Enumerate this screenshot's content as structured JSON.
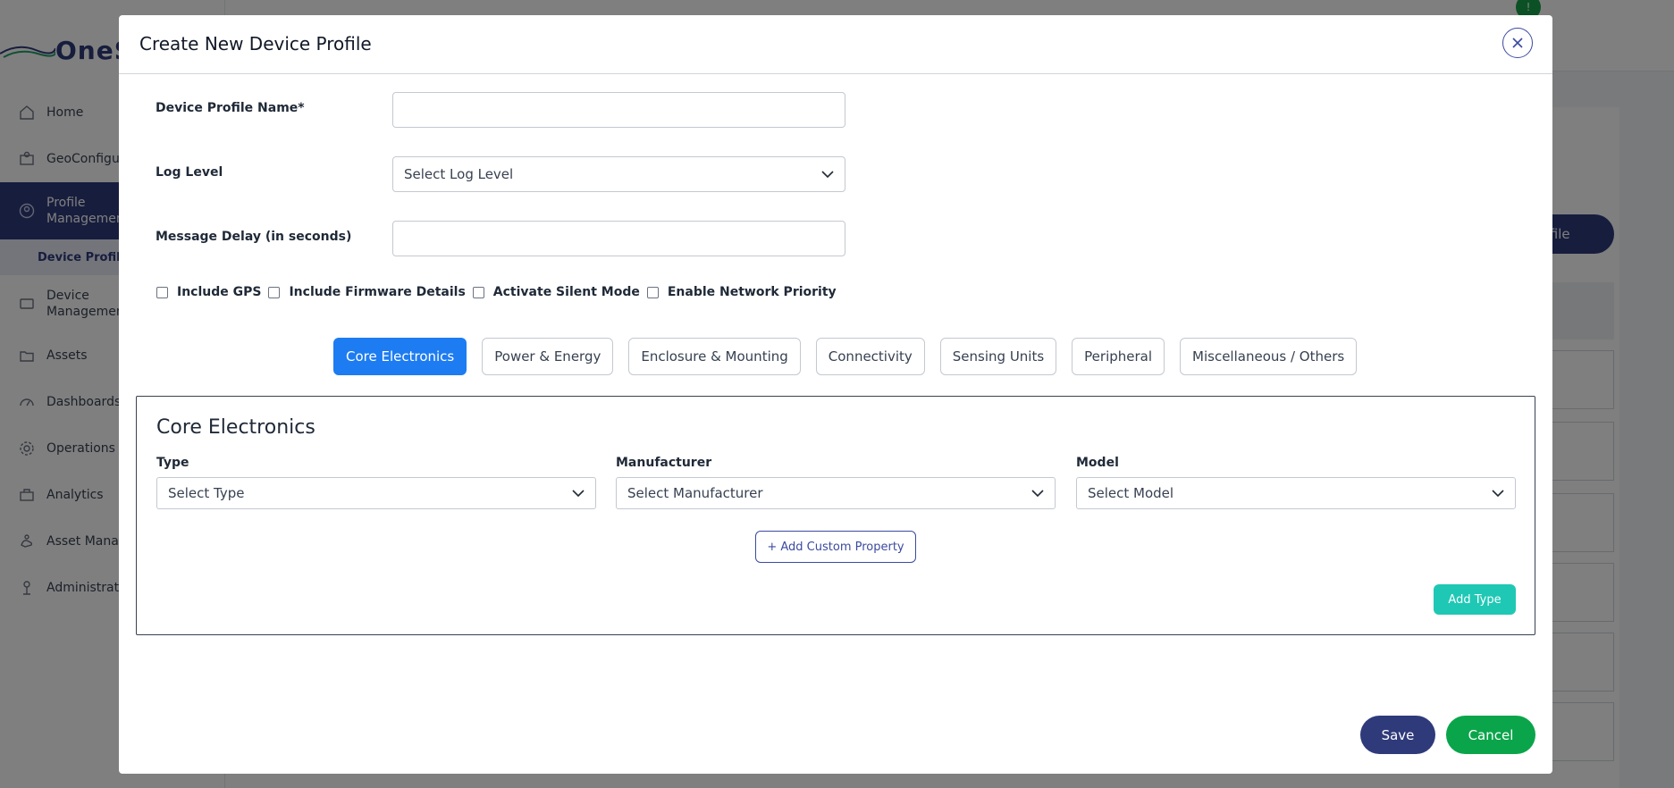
{
  "app": {
    "logo_text": "OneS",
    "status_badge": "!",
    "add_profile_label": "Profile",
    "nav": [
      {
        "label": "Home",
        "icon": "home-icon"
      },
      {
        "label": "GeoConfigur",
        "icon": "geo-config-icon"
      },
      {
        "label": "Profile",
        "label2": "Managemen",
        "icon": "profile-icon"
      },
      {
        "label": "Device Profiles"
      },
      {
        "label": "Device",
        "label2": "Managemen",
        "icon": "device-icon"
      },
      {
        "label": "Assets",
        "icon": "folder-icon"
      },
      {
        "label": "Dashboards",
        "icon": "dashboard-icon"
      },
      {
        "label": "Operations",
        "icon": "gear-icon"
      },
      {
        "label": "Analytics",
        "icon": "briefcase-icon"
      },
      {
        "label": "Asset Manag",
        "icon": "hand-icon"
      },
      {
        "label": "Administrati",
        "icon": "admin-icon"
      }
    ]
  },
  "modal": {
    "title": "Create New Device Profile",
    "fields": {
      "profile_name": {
        "label": "Device Profile Name*",
        "value": ""
      },
      "log_level": {
        "label": "Log Level",
        "selected": "Select Log Level"
      },
      "message_delay": {
        "label": "Message Delay (in seconds)",
        "value": ""
      }
    },
    "checkboxes": [
      {
        "label": "Include GPS",
        "checked": false
      },
      {
        "label": "Include Firmware Details",
        "checked": false
      },
      {
        "label": "Activate Silent Mode",
        "checked": false
      },
      {
        "label": "Enable Network Priority",
        "checked": false
      }
    ],
    "tabs": [
      {
        "label": "Core Electronics",
        "active": true
      },
      {
        "label": "Power & Energy",
        "active": false
      },
      {
        "label": "Enclosure & Mounting",
        "active": false
      },
      {
        "label": "Connectivity",
        "active": false
      },
      {
        "label": "Sensing Units",
        "active": false
      },
      {
        "label": "Peripheral",
        "active": false
      },
      {
        "label": "Miscellaneous / Others",
        "active": false
      }
    ],
    "panel": {
      "title": "Core Electronics",
      "type": {
        "label": "Type",
        "selected": "Select Type"
      },
      "manufacturer": {
        "label": "Manufacturer",
        "selected": "Select Manufacturer"
      },
      "model": {
        "label": "Model",
        "selected": "Select Model"
      },
      "add_custom_property": "+ Add Custom Property",
      "add_type": "Add Type"
    },
    "save_label": "Save",
    "cancel_label": "Cancel"
  },
  "colors": {
    "brand": "#2f3a7a",
    "tab_active": "#1d7cf2",
    "add_type": "#1fc8b4",
    "cancel": "#0aa54a"
  }
}
